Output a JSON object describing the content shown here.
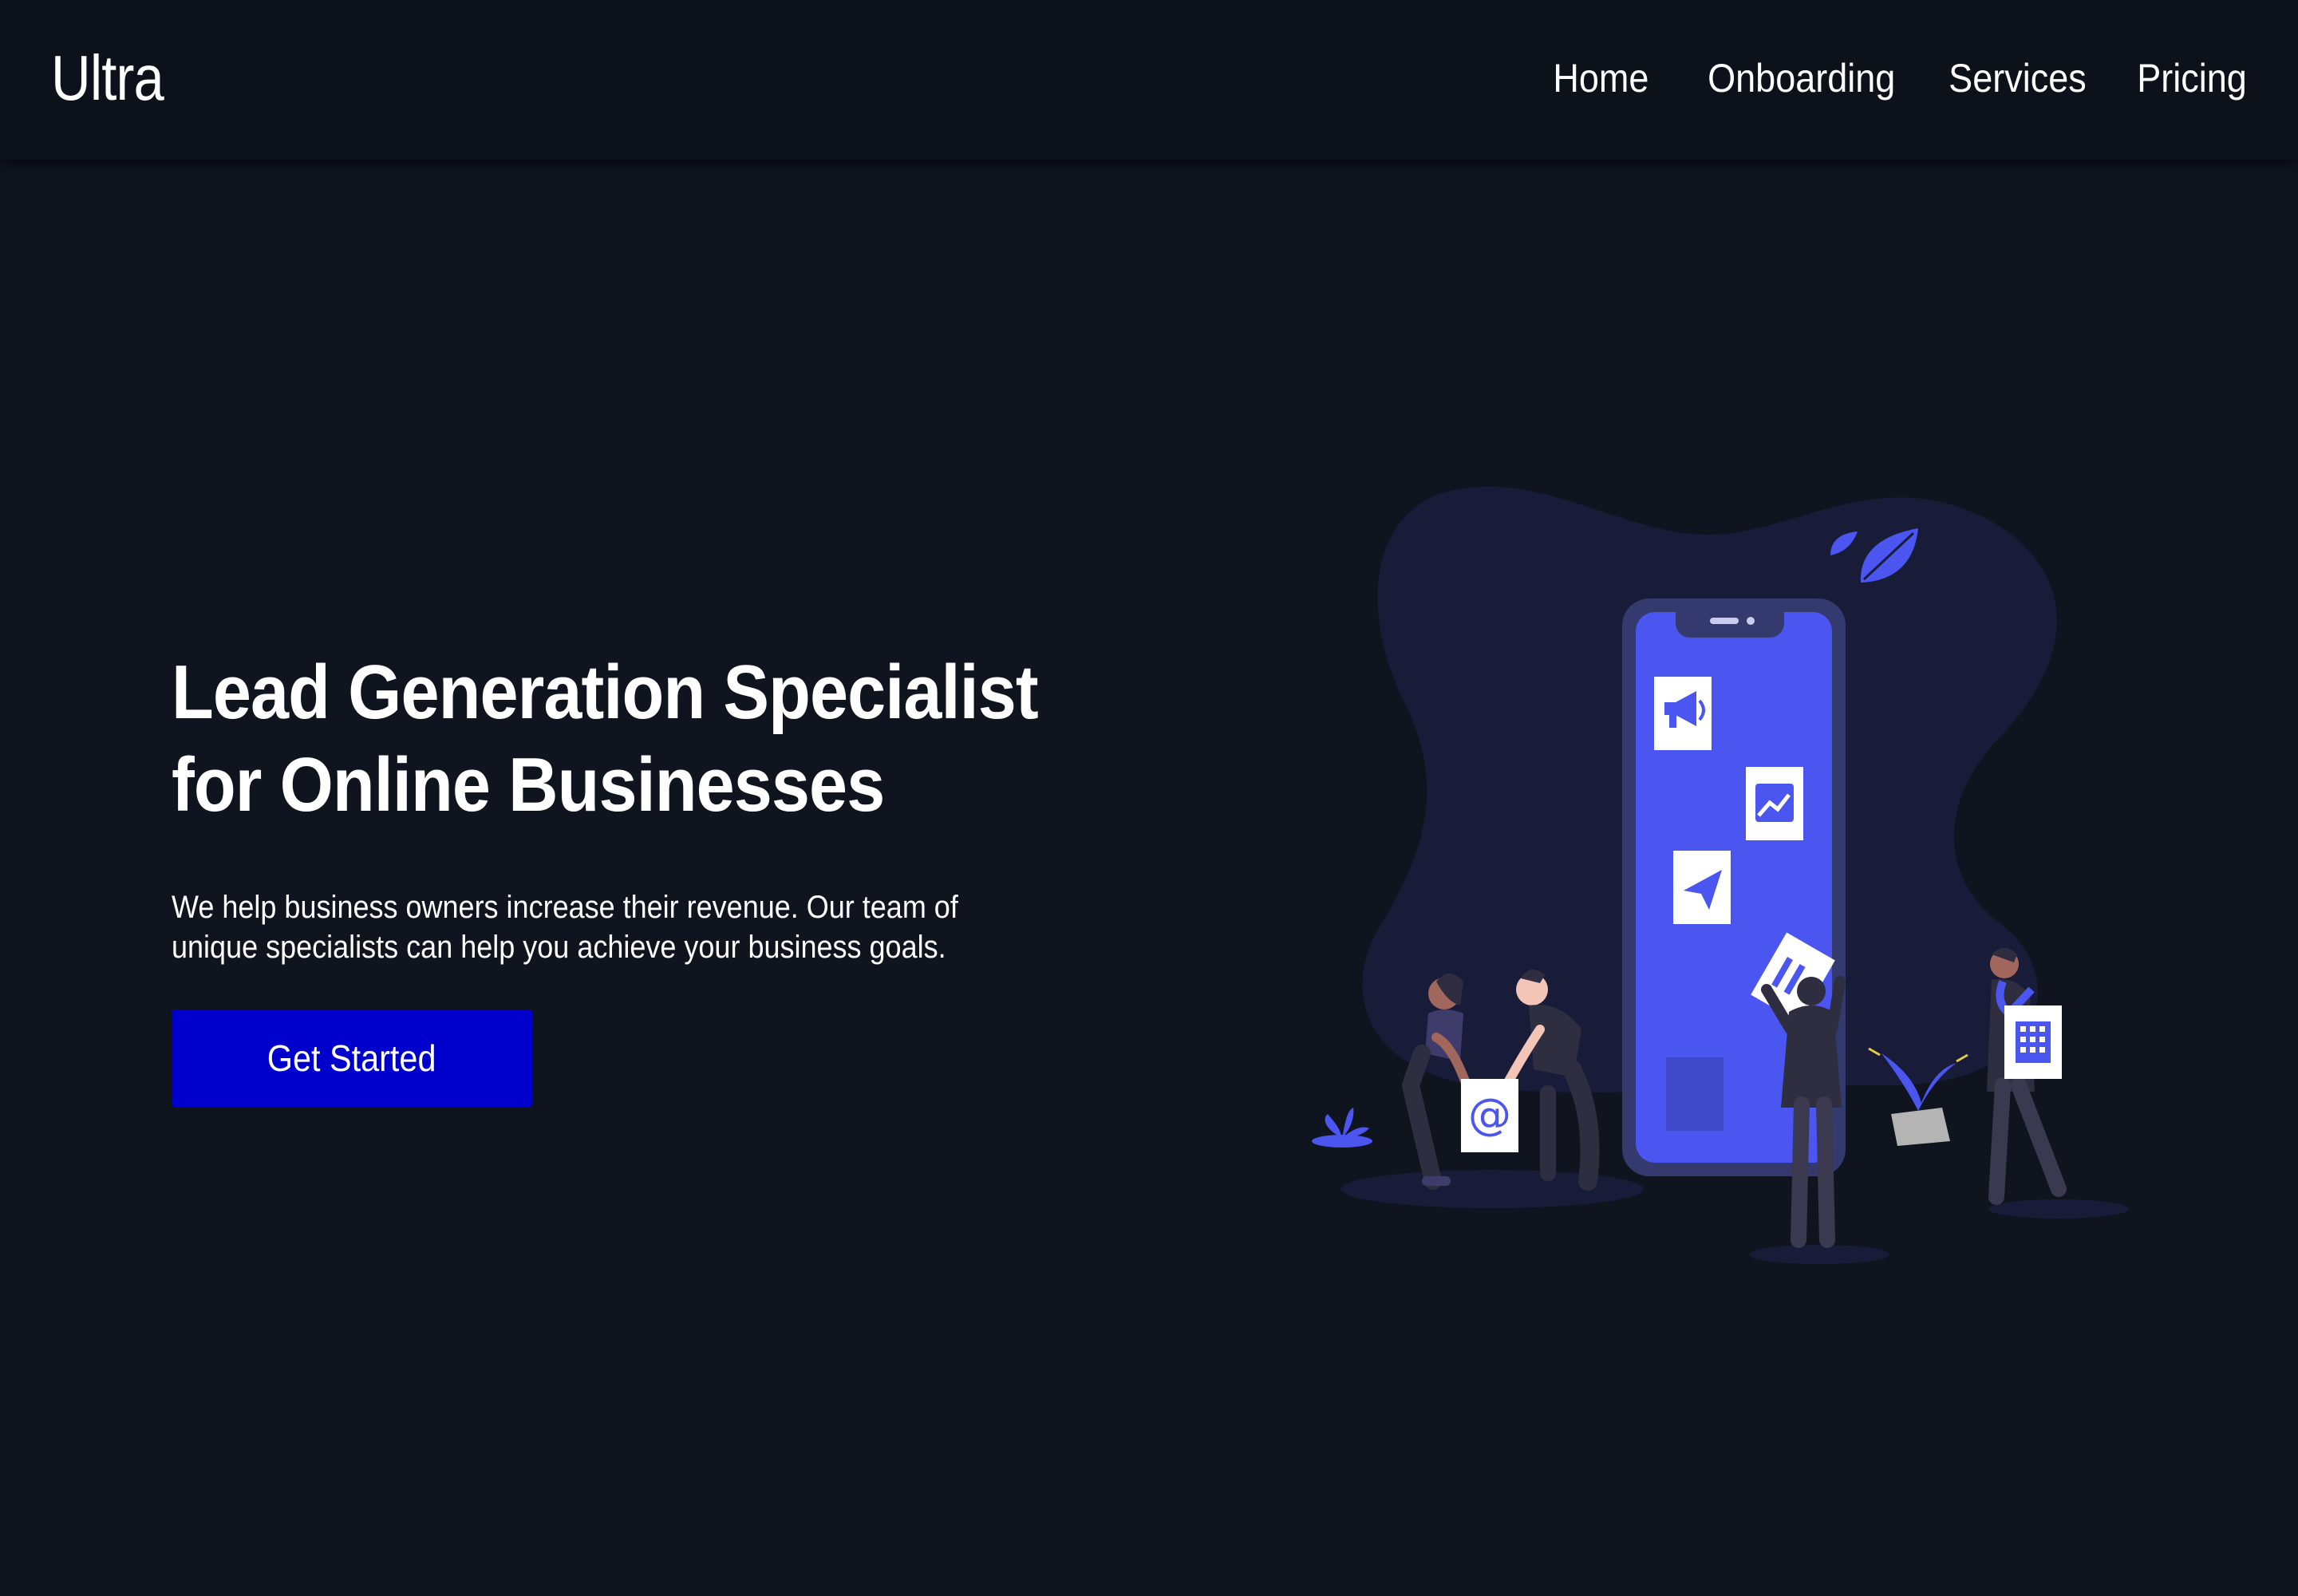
{
  "nav": {
    "brand": "Ultra",
    "links": [
      "Home",
      "Onboarding",
      "Services",
      "Pricing"
    ]
  },
  "hero": {
    "headline_line1": "Lead Generation Specialist",
    "headline_line2": "for Online Businesses",
    "subtext_line1": "We help business owners increase their revenue. Our team of",
    "subtext_line2": "unique specialists can help you achieve your business goals.",
    "cta_label": "Get Started"
  },
  "illustration": {
    "phone_icons": [
      "megaphone-icon",
      "chart-icon",
      "paper-plane-icon",
      "document-icon"
    ],
    "card_icons": [
      "at-sign-icon",
      "building-icon"
    ],
    "text": {
      "at_sign": "@"
    }
  },
  "colors": {
    "background": "#10141f",
    "navbar": "#0d111a",
    "accent_blue": "#0000cd",
    "illustration_primary": "#4b55f0",
    "blob": "#181c39"
  }
}
